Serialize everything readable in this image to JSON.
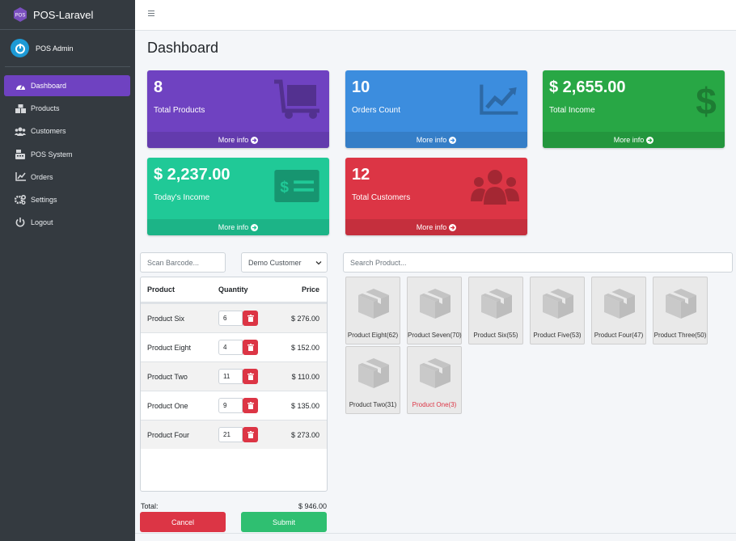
{
  "brand": {
    "name": "POS-Laravel",
    "logo_text": "POS"
  },
  "user": {
    "name": "POS Admin"
  },
  "nav": [
    {
      "label": "Dashboard",
      "icon": "dashboard-icon"
    },
    {
      "label": "Products",
      "icon": "products-icon"
    },
    {
      "label": "Customers",
      "icon": "customers-icon"
    },
    {
      "label": "POS System",
      "icon": "pos-icon"
    },
    {
      "label": "Orders",
      "icon": "orders-icon"
    },
    {
      "label": "Settings",
      "icon": "settings-icon"
    },
    {
      "label": "Logout",
      "icon": "logout-icon"
    }
  ],
  "page": {
    "title": "Dashboard"
  },
  "boxes": [
    {
      "value": "8",
      "label": "Total Products",
      "more": "More info",
      "color": "#6f42c1",
      "icon": "dolly-icon"
    },
    {
      "value": "10",
      "label": "Orders Count",
      "more": "More info",
      "color": "#3c8dde",
      "icon": "chart-line-icon"
    },
    {
      "value": "$ 2,655.00",
      "label": "Total Income",
      "more": "More info",
      "color": "#28a745",
      "icon": "dollar-icon"
    },
    {
      "value": "$ 2,237.00",
      "label": "Today's Income",
      "more": "More info",
      "color": "#20c997",
      "icon": "money-bill-icon"
    },
    {
      "value": "12",
      "label": "Total Customers",
      "more": "More info",
      "color": "#dc3545",
      "icon": "users-icon"
    }
  ],
  "pos": {
    "barcode_placeholder": "Scan Barcode...",
    "customer_selected": "Demo Customer",
    "search_placeholder": "Search Product...",
    "headers": {
      "product": "Product",
      "quantity": "Quantity",
      "price": "Price"
    },
    "cart": [
      {
        "product": "Product Six",
        "qty": "6",
        "price": "$ 276.00"
      },
      {
        "product": "Product Eight",
        "qty": "4",
        "price": "$ 152.00"
      },
      {
        "product": "Product Two",
        "qty": "11",
        "price": "$ 110.00"
      },
      {
        "product": "Product One",
        "qty": "9",
        "price": "$ 135.00"
      },
      {
        "product": "Product Four",
        "qty": "21",
        "price": "$ 273.00"
      }
    ],
    "total_label": "Total:",
    "total_value": "$ 946.00",
    "cancel": "Cancel",
    "submit": "Submit"
  },
  "products": [
    {
      "name": "Product Eight(62)",
      "low": false
    },
    {
      "name": "Product Seven(70)",
      "low": false
    },
    {
      "name": "Product Six(55)",
      "low": false
    },
    {
      "name": "Product Five(53)",
      "low": false
    },
    {
      "name": "Product Four(47)",
      "low": false
    },
    {
      "name": "Product Three(50)",
      "low": false
    },
    {
      "name": "Product Two(31)",
      "low": false
    },
    {
      "name": "Product One(3)",
      "low": true
    }
  ],
  "colors": {
    "sidebar": "#343a40",
    "accent": "#6f42c1",
    "danger": "#dc3545",
    "success": "#2fbf71"
  }
}
